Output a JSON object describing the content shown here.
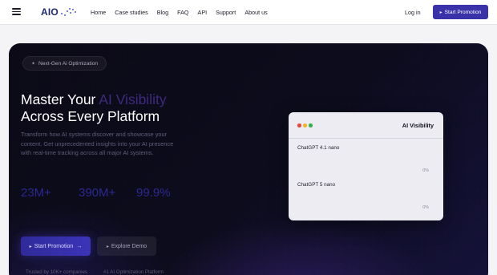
{
  "nav": {
    "logo_text": "AIO",
    "links": [
      "Home",
      "Case studies",
      "Blog",
      "FAQ",
      "API",
      "Support",
      "About us"
    ],
    "login": "Log in",
    "cta": "Start Promotion"
  },
  "hero": {
    "badge": "Next-Gen Ai Optimization",
    "title_part1": "Master Your ",
    "title_accent": "AI Visibility",
    "title_part2": "Across Every Platform",
    "description": "Transform how AI systems discover and showcase your content. Get unprecedented insights into your AI presence with real-time tracking across all major AI systems.",
    "stats": [
      {
        "value": "23M+",
        "label": ""
      },
      {
        "value": "390M+",
        "label": ""
      },
      {
        "value": "99.9%",
        "label": ""
      }
    ],
    "primary_button": "Start Promotion",
    "primary_arrow": "→",
    "secondary_button": "Explore Demo",
    "trust": [
      "Trusted by 10K+ companies",
      "#1 AI Optimization Platform"
    ]
  },
  "preview": {
    "title": "AI Visibility",
    "rows": [
      {
        "label": "ChatGPT 4.1 nano",
        "percent": "0%"
      },
      {
        "label": "ChatGPT 5 nano",
        "percent": "0%"
      }
    ],
    "dot_colors": [
      "#e5483d",
      "#f0b429",
      "#35b04a"
    ]
  },
  "colors": {
    "accent": "#3a32a8",
    "hero_bg": "#0b0a16",
    "stat_color": "#2b2890"
  }
}
